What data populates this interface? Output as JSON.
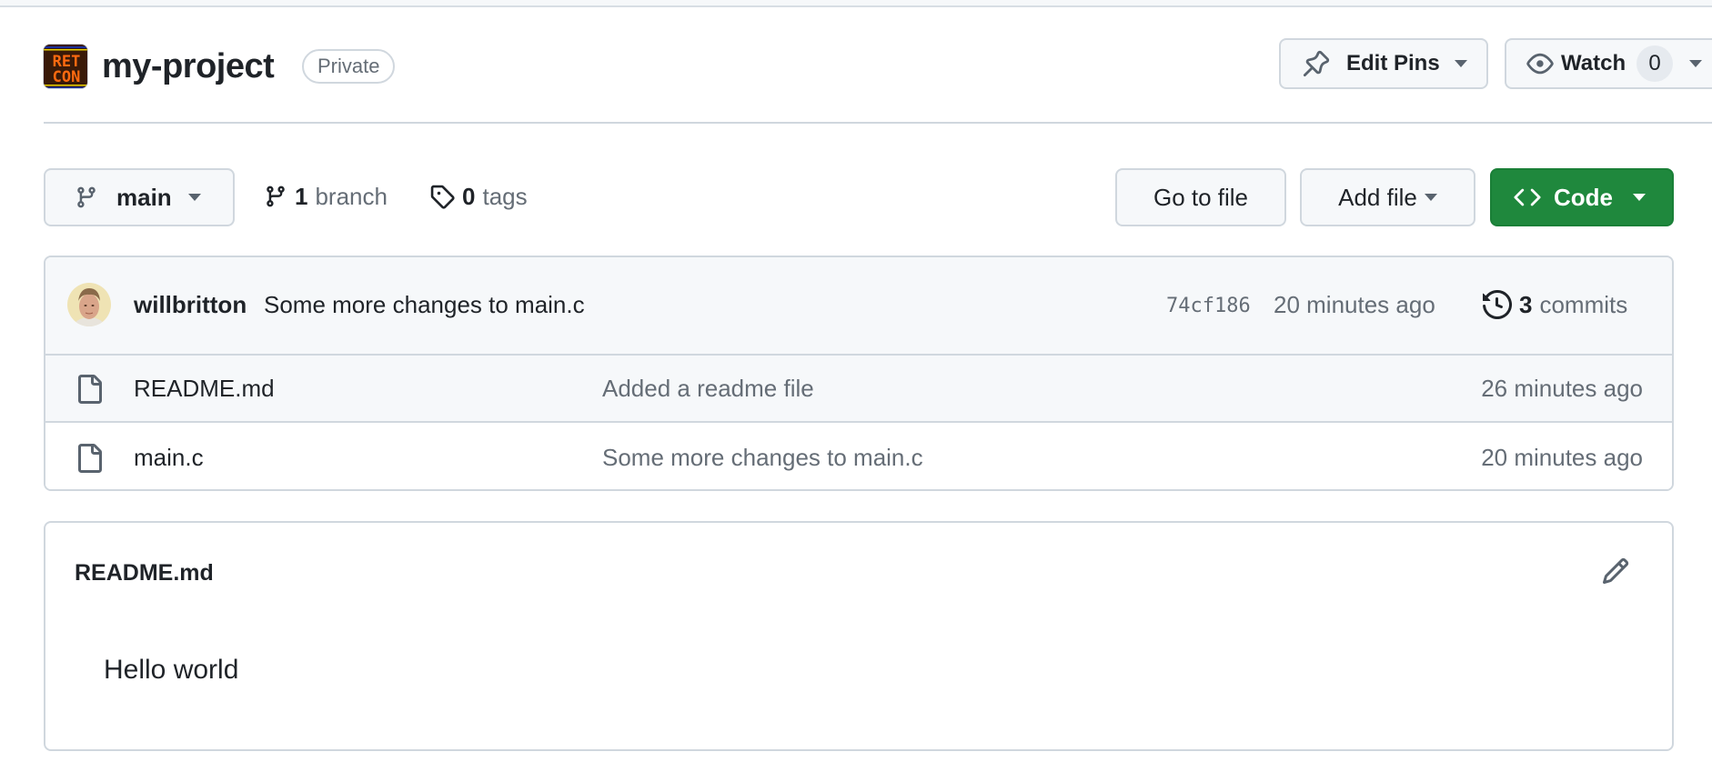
{
  "repo": {
    "name": "my-project",
    "visibility": "Private",
    "avatar_text": [
      "RET",
      "CON"
    ]
  },
  "header_actions": {
    "edit_pins_label": "Edit Pins",
    "watch_label": "Watch",
    "watch_count": "0"
  },
  "branch_bar": {
    "current_branch": "main",
    "branch_count": "1",
    "branch_label": "branch",
    "tag_count": "0",
    "tag_label": "tags",
    "go_to_file_label": "Go to file",
    "add_file_label": "Add file",
    "code_label": "Code"
  },
  "latest_commit": {
    "author": "willbritton",
    "message": "Some more changes to main.c",
    "sha": "74cf186",
    "time": "20 minutes ago",
    "commit_count": "3",
    "commit_label": "commits"
  },
  "files": [
    {
      "name": "README.md",
      "last_commit_message": "Added a readme file",
      "last_commit_time": "26 minutes ago",
      "type": "file-icon"
    },
    {
      "name": "main.c",
      "last_commit_message": "Some more changes to main.c",
      "last_commit_time": "20 minutes ago",
      "type": "file-icon"
    }
  ],
  "readme": {
    "title": "README.md",
    "content": "Hello world"
  },
  "colors": {
    "primary_green": "#1f883d",
    "border": "#d0d7de",
    "muted_text": "#656d76",
    "text": "#1f2328",
    "subtle_bg": "#f6f8fa"
  }
}
